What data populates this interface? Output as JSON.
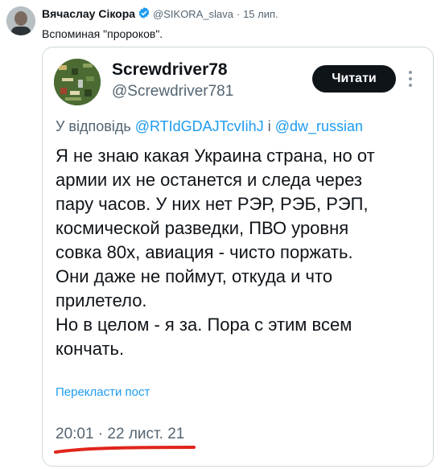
{
  "outer_tweet": {
    "author_name": "Вячаслау Сікора",
    "handle": "@SIKORA_slava",
    "separator": "·",
    "date": "15 лип.",
    "text": "Вспоминая \"пророков\"."
  },
  "embedded_tweet": {
    "author_name": "Screwdriver78",
    "handle": "@Screwdriver781",
    "follow_label": "Читати",
    "reply_prefix": "У відповідь",
    "reply_mention_1": "@RTIdGDAJTcvIihJ",
    "reply_joiner": "і",
    "reply_mention_2": "@dw_russian",
    "body_lines": [
      "Я не знаю какая Украина страна, но от",
      "армии их не останется и следа через",
      "пару часов. У них нет РЭР, РЭБ, РЭП,",
      "космической разведки, ПВО уровня",
      "совка 80х, авиация - чисто поржать.",
      "Они даже не поймут, откуда и что",
      "прилетело.",
      "Но в целом - я за. Пора с этим всем",
      "кончать."
    ],
    "translate_label": "Перекласти пост",
    "timestamp": "20:01 · 22 лист. 21"
  },
  "colors": {
    "accent": "#1d9bf0",
    "text": "#0f1419",
    "muted": "#536471",
    "underline": "#e0251b"
  },
  "icons": [
    "verified-badge-icon",
    "more-options-icon"
  ]
}
